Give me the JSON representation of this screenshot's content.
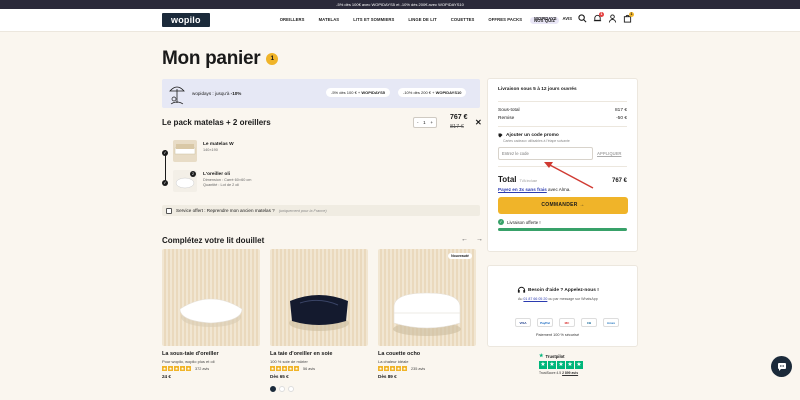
{
  "promo_bar": {
    "text": "-5% dès 100€ avec WOPIDAYS5 et -10% dès 200€ avec WOPIDAYS10"
  },
  "header": {
    "logo": "wopilo",
    "nav": [
      "OREILLERS",
      "MATELAS",
      "LITS ET SOMMIERS",
      "LINGE DE LIT",
      "COUETTES",
      "OFFRES PACKS"
    ],
    "quiz": "NOS QUIZ",
    "wopidays": "WOPIDAYS",
    "avis": "AVIS",
    "wishlist_count": "1",
    "cart_count": "1"
  },
  "page": {
    "title": "Mon panier",
    "count": "1"
  },
  "promo_banner": {
    "text_prefix": "wopidays : jusqu'à ",
    "text_bold": "-10%",
    "code1_prefix": "-5% dès 100 € + ",
    "code1": "WOPIDAYS5",
    "code2_prefix": "-10% dès 200 € + ",
    "code2": "WOPIDAYS10"
  },
  "cart": {
    "pack_title": "Le pack matelas + 2 oreillers",
    "qty_minus": "-",
    "qty": "1",
    "qty_plus": "+",
    "price_now": "767 €",
    "price_old": "817 €",
    "remove": "✕",
    "items": [
      {
        "name": "Le matelas W",
        "sub1": "140×190",
        "sub2": ""
      },
      {
        "name": "L'oreiller oli",
        "sub1": "Dimension : Carré 60×60 cm",
        "sub2": "Quantité : Lot de 2 oli",
        "count": "2"
      }
    ]
  },
  "service": {
    "label": "Service offert : Reprendre mon ancien matelas ?",
    "note": "(uniquement pour la France)"
  },
  "reco": {
    "title": "Complétez votre lit douillet",
    "prev": "←",
    "next": "→",
    "cards": [
      {
        "name": "La sous-taie d'oreiller",
        "sub": "Pour wopilo, wopilo plus et oli",
        "reviews": "372 avis",
        "price": "24 €",
        "badge": ""
      },
      {
        "name": "La taie d'oreiller en soie",
        "sub": "100 % soie de mûrier",
        "reviews": "56 avis",
        "price": "Dès 65 €",
        "badge": ""
      },
      {
        "name": "La couette ocho",
        "sub": "La chaleur idéale",
        "reviews": "235 avis",
        "price": "Dès 89 €",
        "badge": "Nouveauté"
      }
    ]
  },
  "summary": {
    "delivery": "Livraison sous 5 à 12 jours ouvrés",
    "subtotal_label": "Sous-total",
    "subtotal": "817 €",
    "discount_label": "Remise",
    "discount": "-50 €",
    "promo_label": "Ajouter un code promo",
    "promo_help": "Cartes cadeaux utilisables à l'étape suivante",
    "promo_placeholder": "Entrez le code",
    "apply": "APPLIQUER",
    "total_label": "Total",
    "total_ttc": "TVA incluse",
    "total": "767 €",
    "alma_link": "Payez en 3x sans frais",
    "alma_suffix": " avec Alma.",
    "order": "COMMANDER  →",
    "offered": "Livraison offerte !",
    "offered_progress": 1
  },
  "help": {
    "title": "Besoin d'aide ? Appelez-nous !",
    "phone": "01 87 66 05 20",
    "sub_prefix": "Au ",
    "sub_suffix": " ou par message sur WhatsApp",
    "secure": "Paiement 100 % sécurisé",
    "payments": [
      "VISA",
      "PayPal",
      "MC",
      "CB",
      "Amex"
    ]
  },
  "trustpilot": {
    "brand": "Trustpilot",
    "score_prefix": "TrustScore 4.5 ",
    "reviews": "2 899 avis"
  },
  "colors": {
    "accent": "#f0b429",
    "navy": "#1b2a3a",
    "green": "#38a169",
    "arrow": "#d03a32"
  }
}
